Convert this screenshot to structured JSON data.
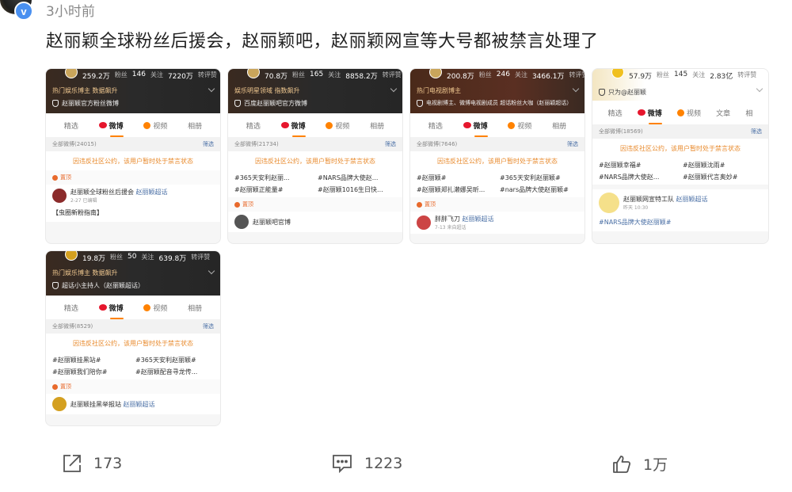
{
  "post": {
    "time": "3小时前",
    "verified_mark": "v",
    "text": "赵丽颖全球粉丝后援会，赵丽颖吧，赵丽颖网宣等大号都被禁言处理了"
  },
  "screenshots": [
    {
      "stats": [
        "259.2万",
        "粉丝",
        "146",
        "关注",
        "7220万",
        "转评赞"
      ],
      "tagline": "热门娱乐博主 数据飙升",
      "org": "赵丽颖官方粉丝微博",
      "tabs": [
        "精选",
        "微博",
        "视频",
        "相册"
      ],
      "filter_left": "全部微博(24015)",
      "filter_right": "筛选",
      "ban": "因违反社区公约，该用户暂时处于禁言状态",
      "pinned": "置顶",
      "user_name": "赵丽颖全球粉丝后援会",
      "user_tag": "赵丽颖超话",
      "user_sub": "2-27  已编辑",
      "post_line": "【虫圈新粉指南】"
    },
    {
      "stats": [
        "70.8万",
        "粉丝",
        "165",
        "关注",
        "8858.2万",
        "转评赞"
      ],
      "tagline": "娱乐明星领域 指数飙升",
      "org": "百度赵丽颖吧官方微博",
      "tabs": [
        "精选",
        "微博",
        "视频",
        "相册"
      ],
      "filter_left": "全部微博(21734)",
      "filter_right": "筛选",
      "ban": "因违反社区公约，该用户暂时处于禁言状态",
      "hashtags": [
        "#365天安利赵丽...",
        "#NARS品牌大使赵...",
        "#赵丽颖正能量#",
        "#赵丽颖1016生日快..."
      ],
      "pinned": "置顶",
      "user_name": "赵丽颖吧官博"
    },
    {
      "stats": [
        "200.8万",
        "粉丝",
        "246",
        "关注",
        "3466.1万",
        "转评赞"
      ],
      "tagline": "热门电视剧博主",
      "org": "电视剧博主、微博电视剧成员 超话粉丝大咖（赵丽颖超话）",
      "tabs": [
        "精选",
        "微博",
        "视频",
        "相册"
      ],
      "filter_left": "全部微博(7646)",
      "filter_right": "筛选",
      "ban": "因违反社区公约，该用户暂时处于禁言状态",
      "hashtags": [
        "#赵丽颖#",
        "#365天安利赵丽颖#",
        "#赵丽颖郑扎濑娜吴昕...",
        "#nars品牌大使赵丽颖#"
      ],
      "pinned": "置顶",
      "user_name": "胖胖飞刀",
      "user_tag": "赵丽颖超话",
      "user_sub": "7-13  来自超话"
    },
    {
      "stats": [
        "57.9万",
        "粉丝",
        "145",
        "关注",
        "2.83亿",
        "转评赞"
      ],
      "org": "只为@赵丽颖",
      "tabs": [
        "精选",
        "微博",
        "视频",
        "文章",
        "相"
      ],
      "filter_left": "全部微博(18569)",
      "filter_right": "筛选",
      "ban": "因违反社区公约，该用户暂时处于禁言状态",
      "hashtags": [
        "#赵丽颖幸福#",
        "#赵丽颖沈雨#",
        "#NARS品牌大使赵...",
        "#赵丽颖代言奥妙#"
      ],
      "user_name": "赵丽颖网宣特工队",
      "user_tag": "赵丽颖超话",
      "user_sub": "昨天 10:30",
      "post_line": "#NARS品牌大使赵丽颖#"
    },
    {
      "stats": [
        "19.8万",
        "粉丝",
        "50",
        "关注",
        "639.8万",
        "转评赞"
      ],
      "tagline": "热门娱乐博主 数据飙升",
      "org": "超话小主持人（赵丽颖超话）",
      "tabs": [
        "精选",
        "微博",
        "视频",
        "相册"
      ],
      "filter_left": "全部微博(8529)",
      "filter_right": "筛选",
      "ban": "因违反社区公约，该用户暂时处于禁言状态",
      "hashtags": [
        "#赵丽颖挂黑站#",
        "#365天安利赵丽颖#",
        "#赵丽颖我们陪你#",
        "#赵丽颖配音寻龙传..."
      ],
      "pinned": "置顶",
      "user_name": "赵丽颖挂黑举报站",
      "user_tag": "赵丽颖超话"
    }
  ],
  "actions": {
    "share_count": "173",
    "comment_count": "1223",
    "like_count": "1万"
  },
  "colors": {
    "ban_text": "#e88a2c",
    "weibo_red": "#e6162d",
    "accent_orange": "#ff8200",
    "verified_blue": "#4a90f0"
  }
}
